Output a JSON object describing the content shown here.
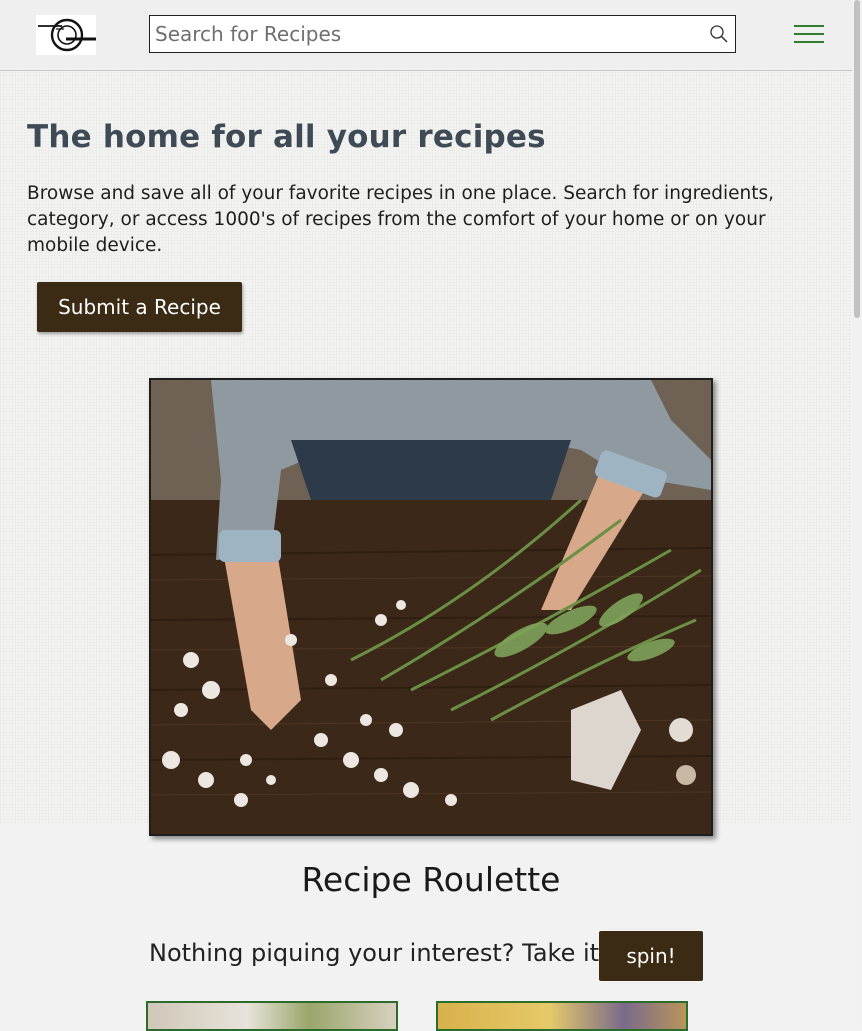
{
  "header": {
    "logo_alt": "Recipe site logo",
    "search_placeholder": "Search for Recipes",
    "search_value": ""
  },
  "hero": {
    "title": "The home for all your recipes",
    "description": "Browse and save all of your favorite recipes in one place. Search for ingredients, category, or access 1000's of recipes from the comfort of your home or on your mobile device.",
    "submit_label": "Submit a Recipe"
  },
  "roulette": {
    "title": "Recipe Roulette",
    "prompt": "Nothing piquing your interest? Take it for a",
    "spin_label": "spin!"
  },
  "icons": {
    "search": "search-icon",
    "menu": "hamburger-menu-icon"
  },
  "colors": {
    "button_brown": "#3b2a14",
    "menu_green": "#2d7d2d",
    "title_slate": "#3e4a55"
  }
}
